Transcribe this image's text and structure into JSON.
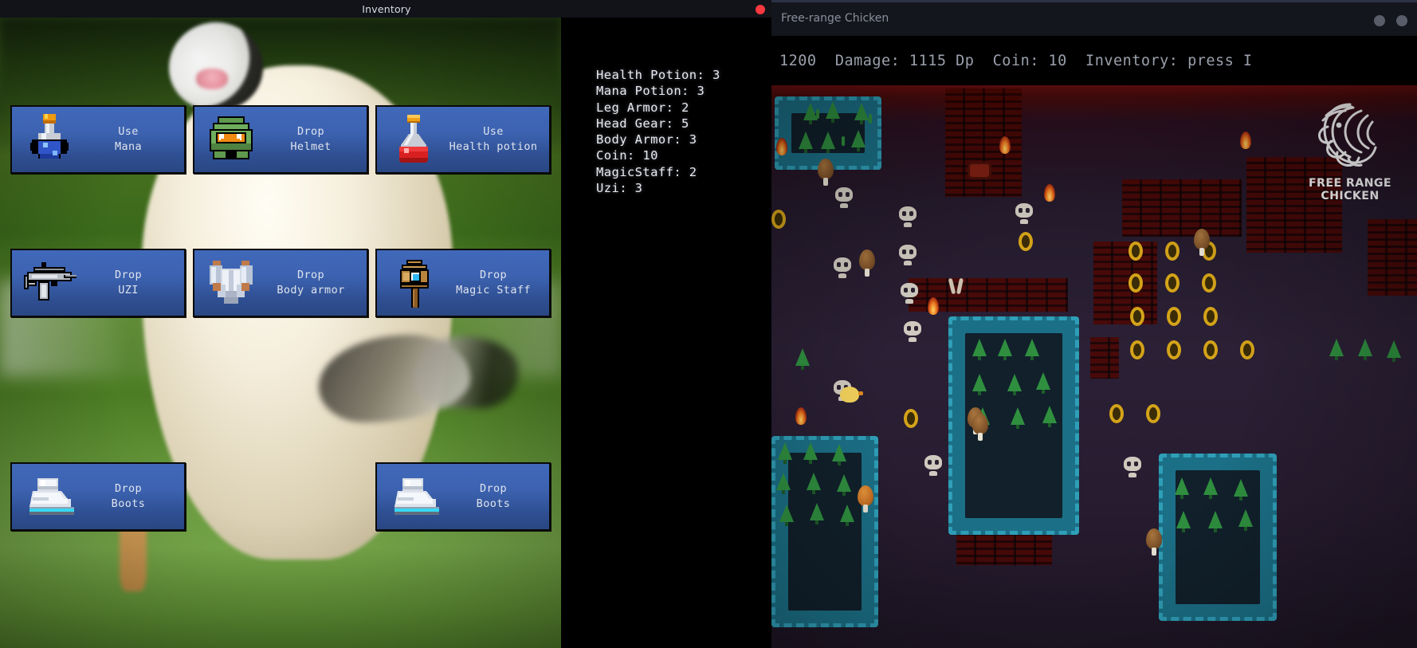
{
  "inventory_window": {
    "title": "Inventory",
    "close_icon": "close-dot-icon",
    "buttons": [
      {
        "action": "Use",
        "item": "Mana",
        "icon": "mana-potion-icon",
        "label": "Use\nMana"
      },
      {
        "action": "Drop",
        "item": "Helmet",
        "icon": "helmet-icon",
        "label": "Drop\nHelmet"
      },
      {
        "action": "Use",
        "item": "Health potion",
        "icon": "health-potion-icon",
        "label": "Use\nHealth potion"
      },
      {
        "action": "Drop",
        "item": "UZI",
        "icon": "uzi-icon",
        "label": "Drop\nUZI"
      },
      {
        "action": "Drop",
        "item": "Body armor",
        "icon": "body-armor-icon",
        "label": "Drop\nBody armor"
      },
      {
        "action": "Drop",
        "item": "Magic Staff",
        "icon": "magic-staff-icon",
        "label": "Drop\nMagic Staff"
      },
      {
        "action": "Drop",
        "item": "Boots",
        "icon": "boots-icon",
        "label": "Drop\nBoots"
      },
      {
        "action": "Drop",
        "item": "Boots",
        "icon": "boots-icon",
        "label": "Drop\nBoots"
      }
    ],
    "stats": [
      "Health Potion: 3",
      "Mana Potion: 3",
      "Leg Armor: 2",
      "Head Gear: 5",
      "Body Armor: 3",
      "Coin: 10",
      "MagicStaff: 2",
      "Uzi: 3"
    ]
  },
  "game_window": {
    "title": "Free-range Chicken",
    "minimize_icon": "minimize-dot-icon",
    "maximize_icon": "maximize-dot-icon",
    "hud": "1200  Damage: 1115 Dp  Coin: 10  Inventory: press I",
    "hud_fields": {
      "score": "1200",
      "damage": "Damage: 1115 Dp",
      "coin": "Coin: 10",
      "inventory_hint": "Inventory: press I"
    },
    "watermark": {
      "text": "FREE RANGE CHICKEN",
      "icon": "chicken-head-logo-icon"
    }
  },
  "colors": {
    "button_blue": "#3c62b0",
    "button_border": "#0a0a0a",
    "close_red": "#f9383f",
    "window_chrome": "#14161d",
    "hud_text": "#9aa0ab",
    "stats_text": "#e8eaef"
  }
}
